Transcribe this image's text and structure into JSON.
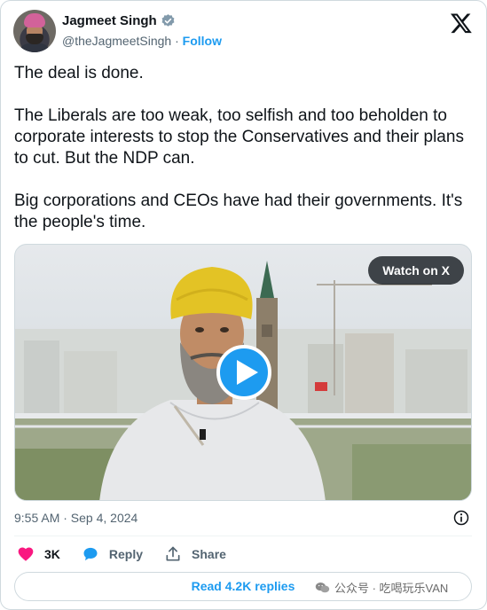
{
  "author": {
    "name": "Jagmeet Singh",
    "handle": "@theJagmeetSingh",
    "separator": " · ",
    "follow_label": "Follow"
  },
  "tweet": {
    "paragraphs": [
      "The deal is done.",
      "The Liberals are too weak, too selfish and too beholden to corporate interests to stop the Conservatives and their plans to cut. But the NDP can.",
      "Big corporations and CEOs have had their governments. It's the people's time."
    ]
  },
  "media": {
    "watch_label": "Watch on X"
  },
  "timestamp": "9:55 AM · Sep 4, 2024",
  "actions": {
    "like_count": "3K",
    "reply_label": "Reply",
    "share_label": "Share"
  },
  "read_replies_label": "Read 4.2K replies",
  "watermark": "公众号 · 吃喝玩乐VAN",
  "colors": {
    "accent": "#1d9bf0",
    "like": "#f91880",
    "text": "#0f1419",
    "muted": "#536471"
  }
}
